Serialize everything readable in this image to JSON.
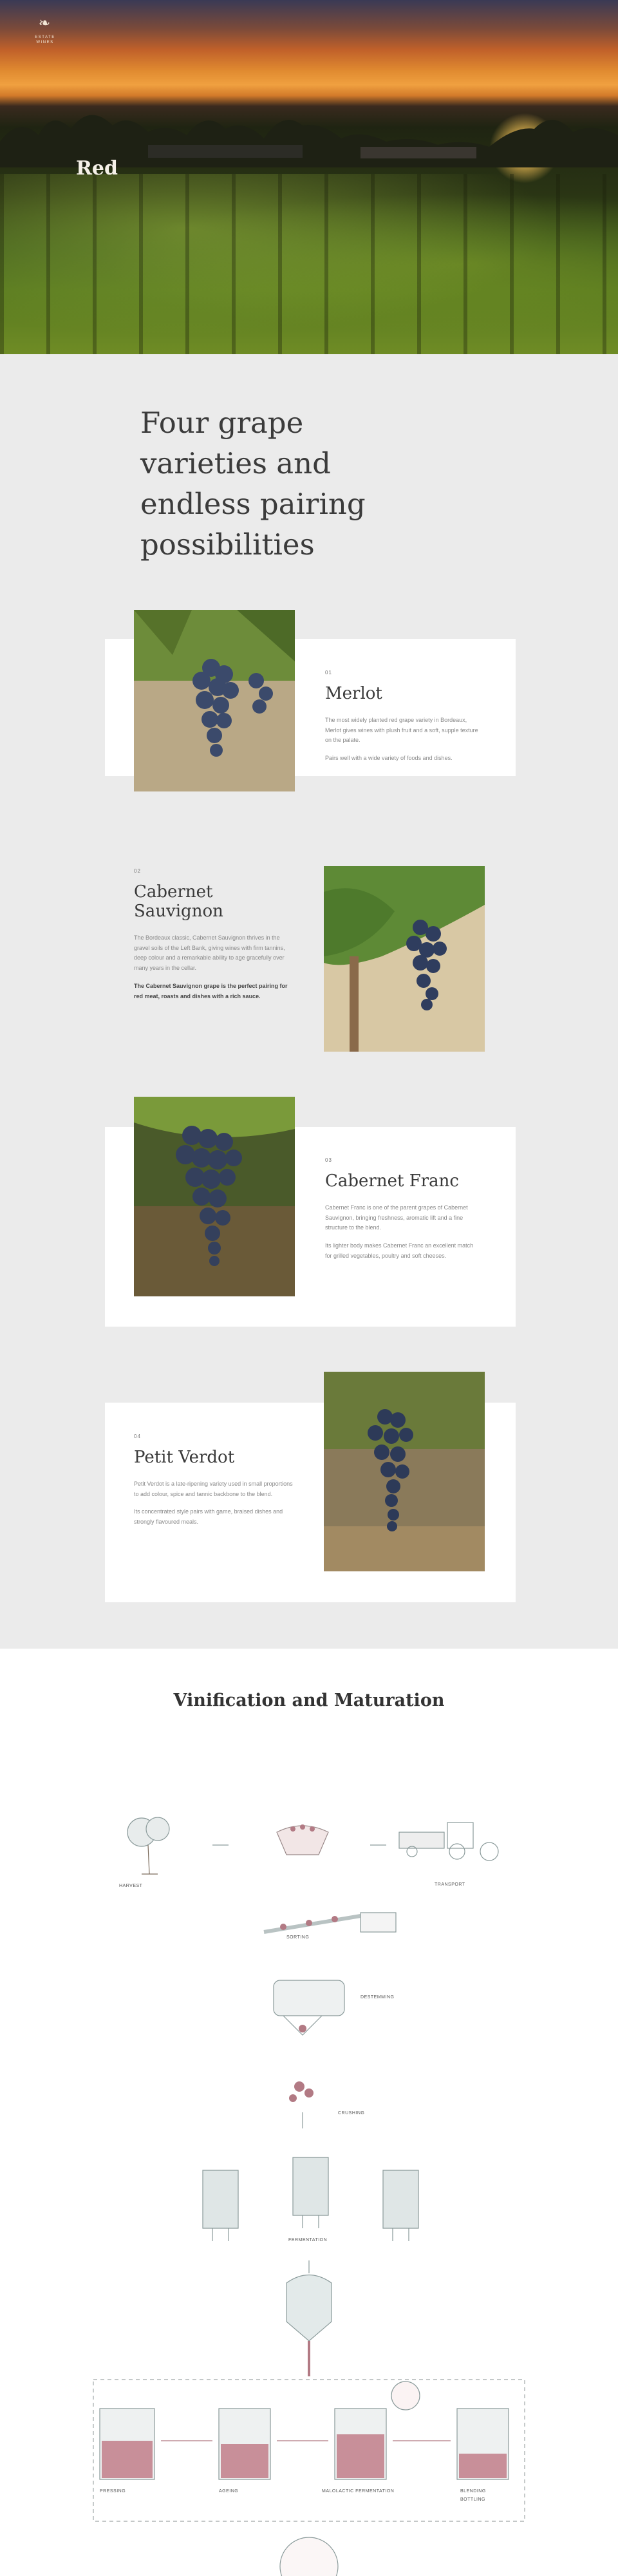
{
  "brand": {
    "logo_mark": "❧",
    "logo_sub": "ESTATE WINES"
  },
  "hero": {
    "title": "Red"
  },
  "grapes": {
    "headline": "Four grape varieties and endless pairing possibilities",
    "items": [
      {
        "number": "01",
        "name": "Merlot",
        "paragraphs": [
          "The most widely planted red grape variety in Bordeaux, Merlot gives wines with plush fruit and a soft, supple texture on the palate.",
          "Pairs well with a wide variety of foods and dishes."
        ],
        "accent": "#3b4a6b"
      },
      {
        "number": "02",
        "name": "Cabernet Sauvignon",
        "paragraphs": [
          "The Bordeaux classic, Cabernet Sauvignon thrives in the gravel soils of the Left Bank, giving wines with firm tannins, deep colour and a remarkable ability to age gracefully over many years in the cellar.",
          "The Cabernet Sauvignon grape is the perfect pairing for red meat, roasts and dishes with a rich sauce."
        ],
        "accent": "#2f3d5e"
      },
      {
        "number": "03",
        "name": "Cabernet Franc",
        "paragraphs": [
          "Cabernet Franc is one of the parent grapes of Cabernet Sauvignon, bringing freshness, aromatic lift and a fine structure to the blend.",
          "Its lighter body makes Cabernet Franc an excellent match for grilled vegetables, poultry and soft cheeses."
        ],
        "accent": "#34405c"
      },
      {
        "number": "04",
        "name": "Petit Verdot",
        "paragraphs": [
          "Petit Verdot is a late-ripening variety used in small proportions to add colour, spice and tannic backbone to the blend.",
          "Its concentrated style pairs with game, braised dishes and strongly flavoured meals."
        ],
        "accent": "#2d3a58"
      }
    ]
  },
  "vinification": {
    "title": "Vinification and Maturation",
    "steps": [
      "HARVEST",
      "TRANSPORT",
      "SORTING",
      "DESTEMMING",
      "CRUSHING",
      "FERMENTATION",
      "PRESSING",
      "MALOLACTIC FERMENTATION",
      "AGEING",
      "BLENDING",
      "BOTTLING"
    ]
  },
  "colors": {
    "section_bg": "#ebebeb",
    "card_bg": "#ffffff",
    "wine": "#b27a84",
    "sketch": "#8a9a9a"
  }
}
